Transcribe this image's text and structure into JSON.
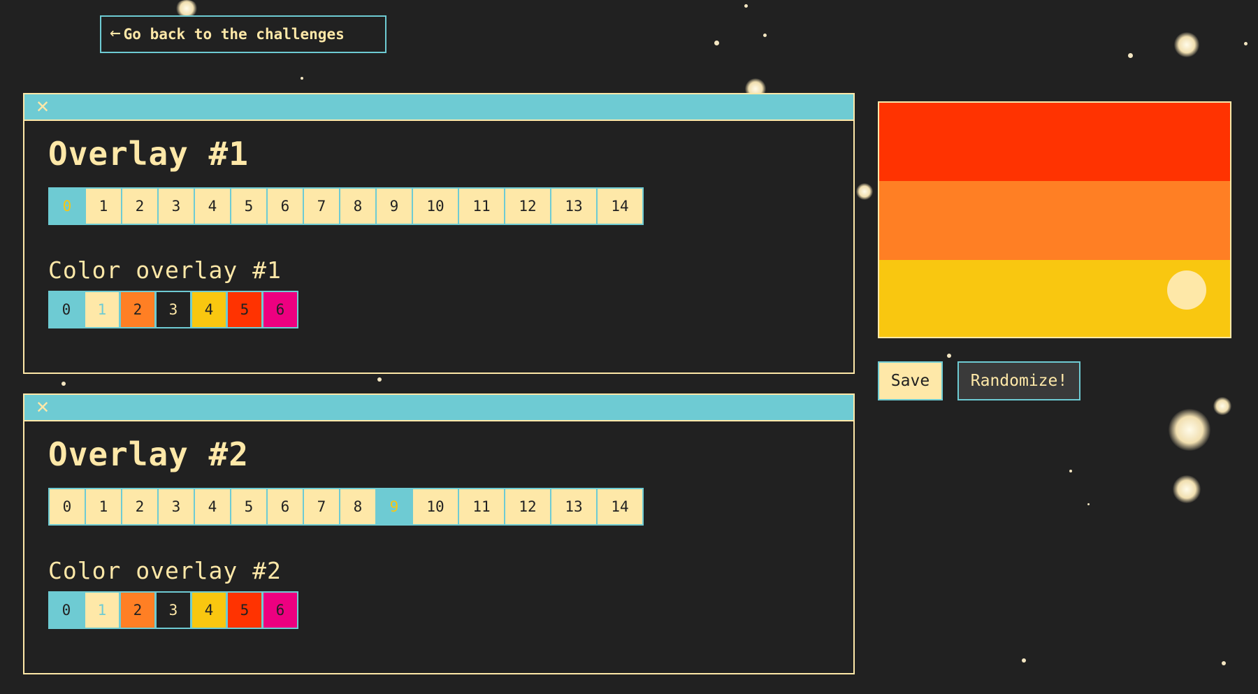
{
  "nav": {
    "back_arrow": "←",
    "back_label": "Go back to the challenges",
    "back_icon": "arrow-left-icon"
  },
  "colors": {
    "background": "#212121",
    "cream": "#fee8a8",
    "teal": "#6ecbd3",
    "orange": "#ff7f24",
    "charcoal": "#212121",
    "yellow": "#f9c710",
    "red": "#ff3301",
    "pink": "#ed0080"
  },
  "overlays": [
    {
      "close_glyph": "✕",
      "title": "Overlay #1",
      "steps": [
        "0",
        "1",
        "2",
        "3",
        "4",
        "5",
        "6",
        "7",
        "8",
        "9",
        "10",
        "11",
        "12",
        "13",
        "14"
      ],
      "selected_step": 0,
      "color_title": "Color overlay #1",
      "color_options": [
        "0",
        "1",
        "2",
        "3",
        "4",
        "5",
        "6"
      ]
    },
    {
      "close_glyph": "✕",
      "title": "Overlay #2",
      "steps": [
        "0",
        "1",
        "2",
        "3",
        "4",
        "5",
        "6",
        "7",
        "8",
        "9",
        "10",
        "11",
        "12",
        "13",
        "14"
      ],
      "selected_step": 9,
      "color_title": "Color overlay #2",
      "color_options": [
        "0",
        "1",
        "2",
        "3",
        "4",
        "5",
        "6"
      ]
    }
  ],
  "swatch_colors": [
    {
      "bg": "#6ecbd3",
      "fg": "#212121"
    },
    {
      "bg": "#fee8a8",
      "fg": "#6ecbd3"
    },
    {
      "bg": "#ff7f24",
      "fg": "#212121"
    },
    {
      "bg": "#212121",
      "fg": "#fee8a8"
    },
    {
      "bg": "#f9c710",
      "fg": "#212121"
    },
    {
      "bg": "#ff3301",
      "fg": "#212121"
    },
    {
      "bg": "#ed0080",
      "fg": "#212121"
    }
  ],
  "preview": {
    "bands": [
      "#ff3301",
      "#ff7f24",
      "#f9c710"
    ],
    "sun_color": "#fee8a8"
  },
  "actions": {
    "save_label": "Save",
    "randomize_label": "Randomize!"
  }
}
